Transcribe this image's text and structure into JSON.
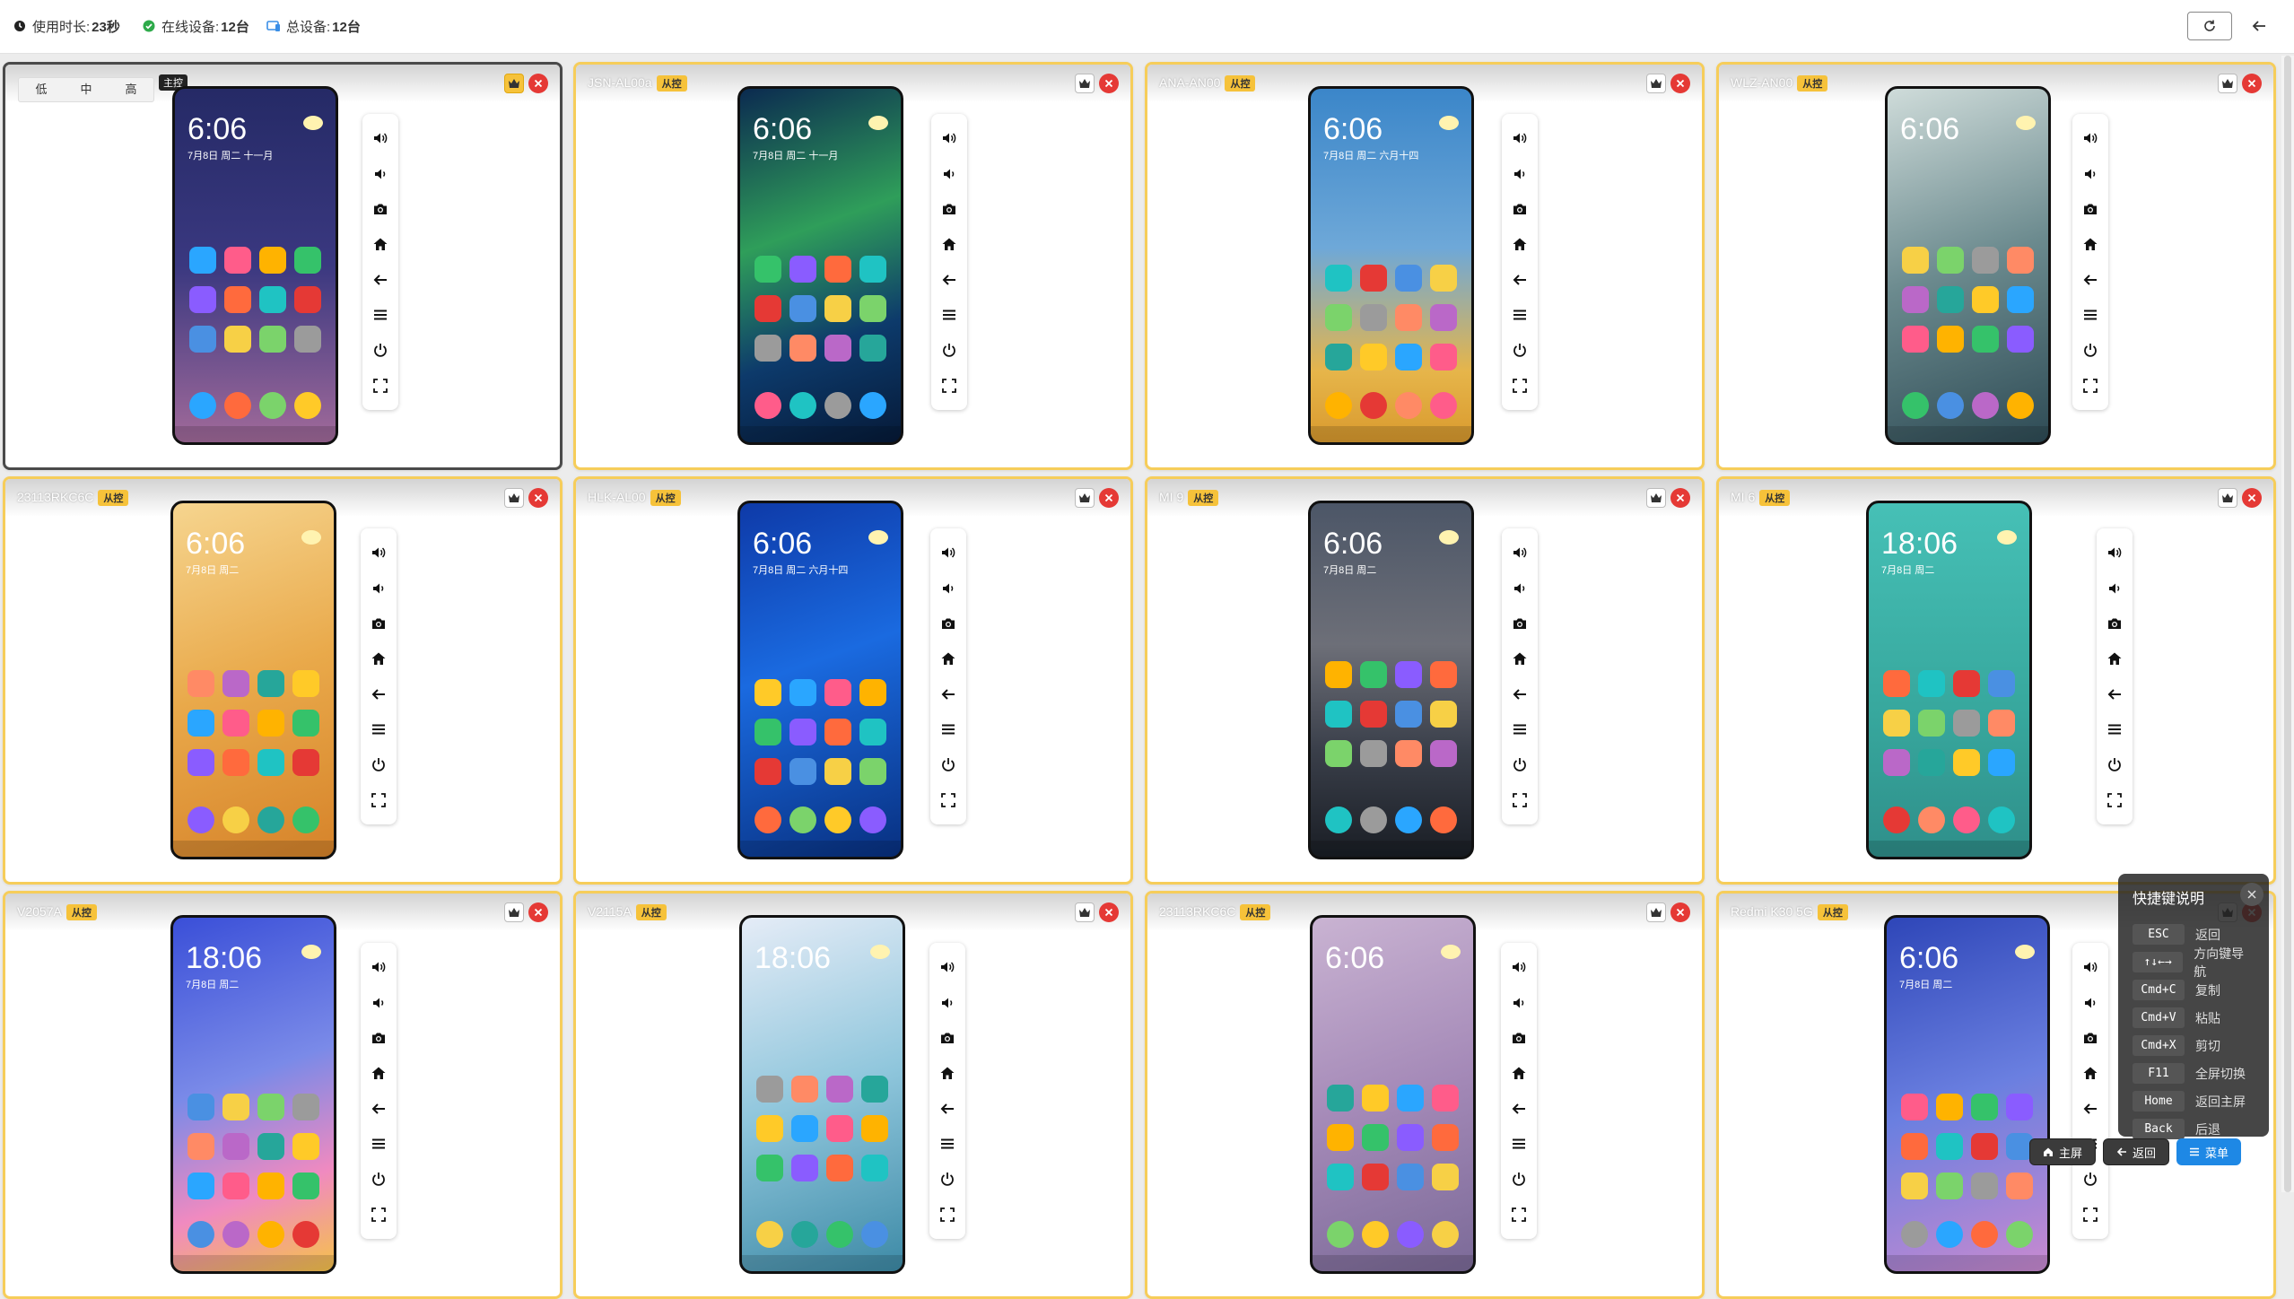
{
  "stats": {
    "usage_label": "使用时长:",
    "usage_value": "23秒",
    "online_label": "在线设备:",
    "online_value": "12台",
    "total_label": "总设备:",
    "total_value": "12台"
  },
  "quality": [
    "低",
    "中",
    "高"
  ],
  "master_tag": "主控",
  "slave_badge": "从控",
  "devices": [
    {
      "name": "",
      "time": "6:06",
      "date": "7月8日 周二 十一月"
    },
    {
      "name": "JSN-AL00a",
      "time": "6:06",
      "date": "7月8日 周二 十一月"
    },
    {
      "name": "ANA-AN00",
      "time": "6:06",
      "date": "7月8日 周二 六月十四"
    },
    {
      "name": "WLZ-AN00",
      "time": "6:06",
      "date": ""
    },
    {
      "name": "23113RKC6C",
      "time": "6:06",
      "date": "7月8日 周二"
    },
    {
      "name": "HLK-AL00",
      "time": "6:06",
      "date": "7月8日 周二 六月十四"
    },
    {
      "name": "MI 9",
      "time": "6:06",
      "date": "7月8日 周二"
    },
    {
      "name": "MI 6",
      "time": "18:06",
      "date": "7月8日 周二"
    },
    {
      "name": "V2057A",
      "time": "18:06",
      "date": "7月8日 周二"
    },
    {
      "name": "V2115A",
      "time": "18:06",
      "date": ""
    },
    {
      "name": "23113RKC6C",
      "time": "6:06",
      "date": ""
    },
    {
      "name": "Redmi K30 5G",
      "time": "6:06",
      "date": "7月8日 周二"
    }
  ],
  "shortcuts": {
    "title": "快捷键说明",
    "items": [
      {
        "key": "ESC",
        "desc": "返回"
      },
      {
        "key": "↑↓←→",
        "desc": "方向键导航"
      },
      {
        "key": "Cmd+C",
        "desc": "复制"
      },
      {
        "key": "Cmd+V",
        "desc": "粘贴"
      },
      {
        "key": "Cmd+X",
        "desc": "剪切"
      },
      {
        "key": "F11",
        "desc": "全屏切换"
      },
      {
        "key": "Home",
        "desc": "返回主屏"
      },
      {
        "key": "Back",
        "desc": "后退"
      }
    ]
  },
  "bottom": {
    "home": "主屏",
    "back": "返回",
    "menu": "菜单"
  },
  "colors": {
    "accent": "#f6c23a",
    "card_border": "#f6cd5a",
    "primary": "#1e88e5",
    "danger": "#e53935"
  },
  "icons": [
    "clock-icon",
    "check-circle-icon",
    "devices-icon",
    "refresh-icon",
    "arrow-left-icon",
    "crown-icon",
    "close-icon",
    "volume-up-icon",
    "volume-down-icon",
    "camera-icon",
    "home-icon",
    "back-icon",
    "menu-icon",
    "power-icon",
    "fullscreen-icon"
  ]
}
